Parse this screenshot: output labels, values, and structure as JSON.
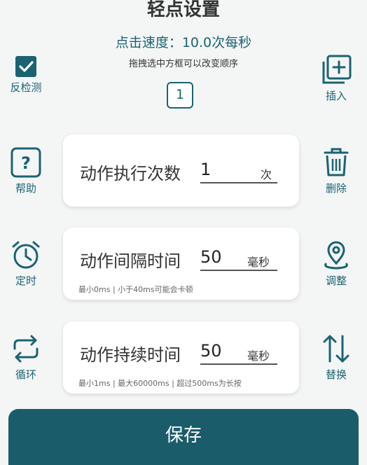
{
  "header": {
    "title": "轻点设置",
    "speed_text": "点击速度：10.0次每秒",
    "hint": "拖拽选中方框可以改变顺序"
  },
  "left_panel": {
    "anti_detect_label": "反检测",
    "anti_detect_checked": true,
    "help_label": "帮助",
    "timer_label": "定时",
    "loop_label": "循环"
  },
  "right_panel": {
    "insert_label": "插入",
    "delete_label": "删除",
    "adjust_label": "调整",
    "swap_label": "替换"
  },
  "selected_index": "1",
  "actions": {
    "exec_count": {
      "label": "动作执行次数",
      "value": "1",
      "unit": "次"
    },
    "interval": {
      "label": "动作间隔时间",
      "value": "50",
      "unit": "毫秒",
      "note": "最小0ms | 小于40ms可能会卡顿"
    },
    "duration": {
      "label": "动作持续时间",
      "value": "50",
      "unit": "毫秒",
      "note": "最小1ms | 最大60000ms | 超过500ms为长按"
    }
  },
  "footer": {
    "save_label": "保存"
  },
  "colors": {
    "accent": "#1b6372",
    "save_bg": "#1b5c6b",
    "background": "#f4f6f6"
  }
}
